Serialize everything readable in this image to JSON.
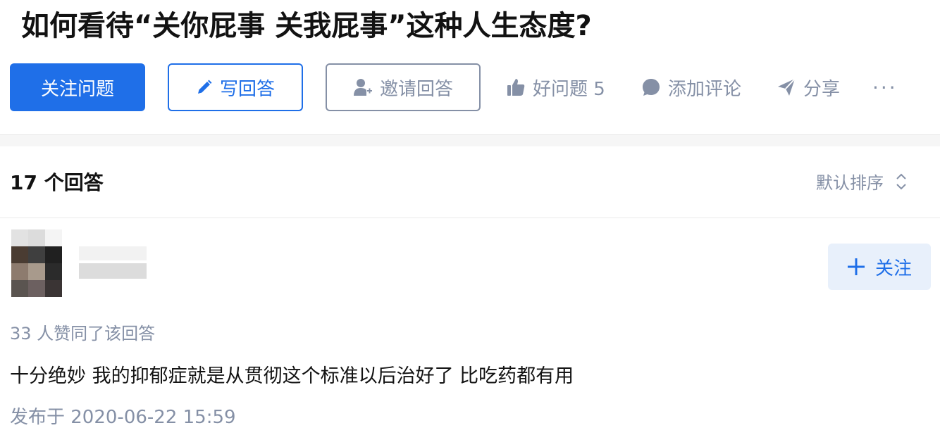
{
  "question": {
    "title": "如何看待“关你屁事 关我屁事”这种人生态度?"
  },
  "actions": {
    "follow_question": "关注问题",
    "write_answer": "写回答",
    "invite_answer": "邀请回答",
    "good_question": "好问题 5",
    "add_comment": "添加评论",
    "share": "分享",
    "more": "···"
  },
  "answers": {
    "count_label": "17 个回答",
    "sort_label": "默认排序",
    "items": [
      {
        "follow_label": "关注",
        "vote_info": "33 人赞同了该回答",
        "content": "十分绝妙 我的抑郁症就是从贯彻这个标准以后治好了 比吃药都有用",
        "published": "发布于 2020-06-22 15:59"
      }
    ]
  },
  "colors": {
    "primary": "#1f6fe8",
    "muted": "#8590a6",
    "text": "#121212",
    "follow_user_bg": "#e8f0fb"
  },
  "icons": {
    "write": "pencil-icon",
    "invite": "add-user-icon",
    "good_question": "thumbs-up-icon",
    "comment": "comment-bubble-icon",
    "share": "paper-plane-icon",
    "sort": "sort-arrows-icon",
    "follow_user": "plus-icon"
  }
}
